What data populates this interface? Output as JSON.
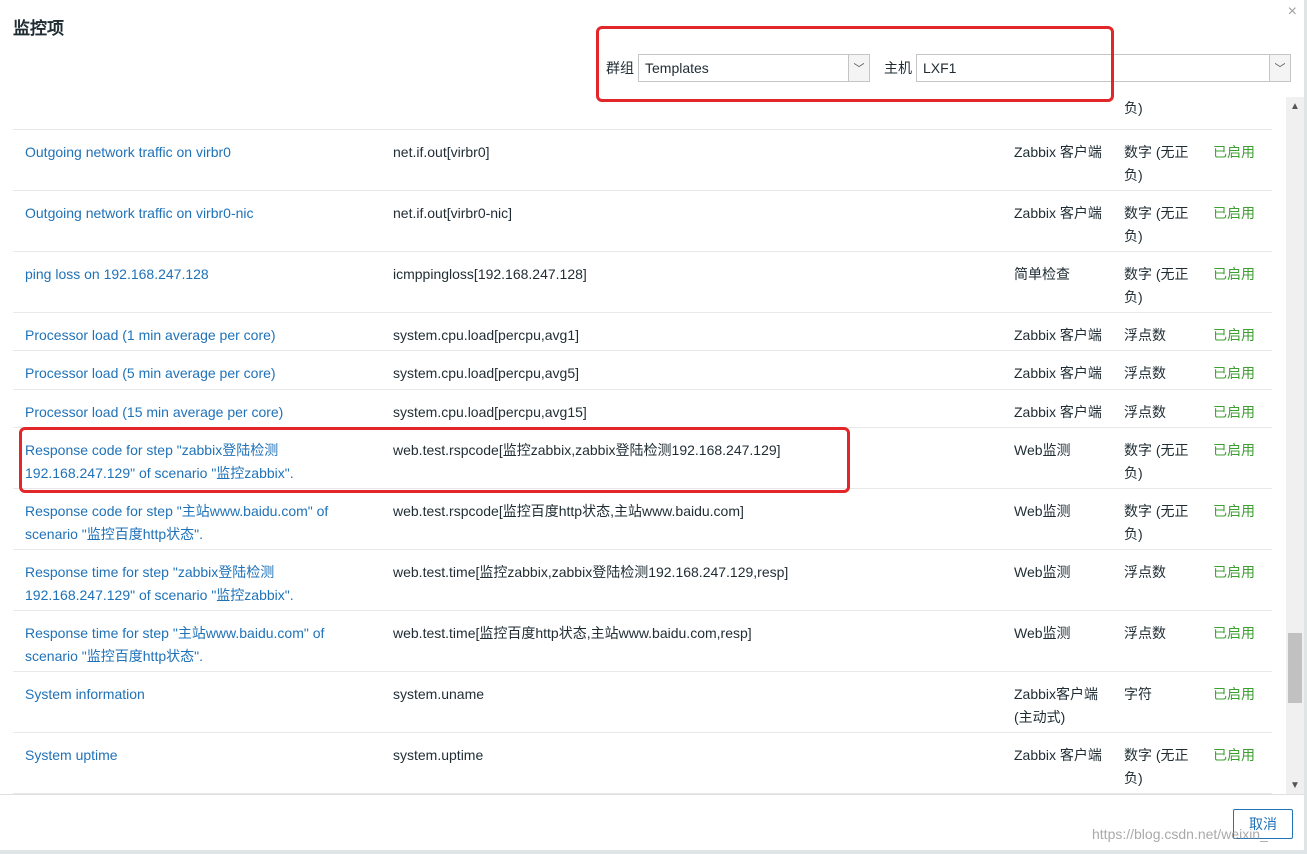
{
  "dialog": {
    "title": "监控项",
    "close": "×",
    "cancel_label": "取消"
  },
  "filters": {
    "group_label": "群组",
    "group_value": "Templates",
    "host_label": "主机",
    "host_value": "LXF1",
    "arrow": "﹀"
  },
  "partial_row": {
    "dtype": "负)"
  },
  "rows": [
    {
      "name": "Outgoing network traffic on virbr0",
      "key": "net.if.out[virbr0]",
      "type": "Zabbix 客户端",
      "dtype": "数字 (无正负)",
      "status": "已启用"
    },
    {
      "name": "Outgoing network traffic on virbr0-nic",
      "key": "net.if.out[virbr0-nic]",
      "type": "Zabbix 客户端",
      "dtype": "数字 (无正负)",
      "status": "已启用"
    },
    {
      "name": "ping loss on 192.168.247.128",
      "key": "icmppingloss[192.168.247.128]",
      "type": "简单检查",
      "dtype": "数字 (无正负)",
      "status": "已启用"
    },
    {
      "name": "Processor load (1 min average per core)",
      "key": "system.cpu.load[percpu,avg1]",
      "type": "Zabbix 客户端",
      "dtype": "浮点数",
      "status": "已启用"
    },
    {
      "name": "Processor load (5 min average per core)",
      "key": "system.cpu.load[percpu,avg5]",
      "type": "Zabbix 客户端",
      "dtype": "浮点数",
      "status": "已启用"
    },
    {
      "name": "Processor load (15 min average per core)",
      "key": "system.cpu.load[percpu,avg15]",
      "type": "Zabbix 客户端",
      "dtype": "浮点数",
      "status": "已启用"
    },
    {
      "name": "Response code for step \"zabbix登陆检测 192.168.247.129\" of scenario \"监控zabbix\".",
      "key": "web.test.rspcode[监控zabbix,zabbix登陆检测192.168.247.129]",
      "type": "Web监测",
      "dtype": "数字 (无正负)",
      "status": "已启用"
    },
    {
      "name": "Response code for step \"主站www.baidu.com\" of scenario \"监控百度http状态\".",
      "key": "web.test.rspcode[监控百度http状态,主站www.baidu.com]",
      "type": "Web监测",
      "dtype": "数字 (无正负)",
      "status": "已启用"
    },
    {
      "name": "Response time for step \"zabbix登陆检测 192.168.247.129\" of scenario \"监控zabbix\".",
      "key": "web.test.time[监控zabbix,zabbix登陆检测192.168.247.129,resp]",
      "type": "Web监测",
      "dtype": "浮点数",
      "status": "已启用"
    },
    {
      "name": "Response time for step \"主站www.baidu.com\" of scenario \"监控百度http状态\".",
      "key": "web.test.time[监控百度http状态,主站www.baidu.com,resp]",
      "type": "Web监测",
      "dtype": "浮点数",
      "status": "已启用"
    },
    {
      "name": "System information",
      "key": "system.uname",
      "type": "Zabbix客户端 (主动式)",
      "dtype": "字符",
      "status": "已启用"
    },
    {
      "name": "System uptime",
      "key": "system.uptime",
      "type": "Zabbix 客户端",
      "dtype": "数字 (无正负)",
      "status": "已启用"
    }
  ],
  "scrollbar": {
    "up": "▲",
    "down": "▼"
  },
  "watermark": "https://blog.csdn.net/weixin_"
}
